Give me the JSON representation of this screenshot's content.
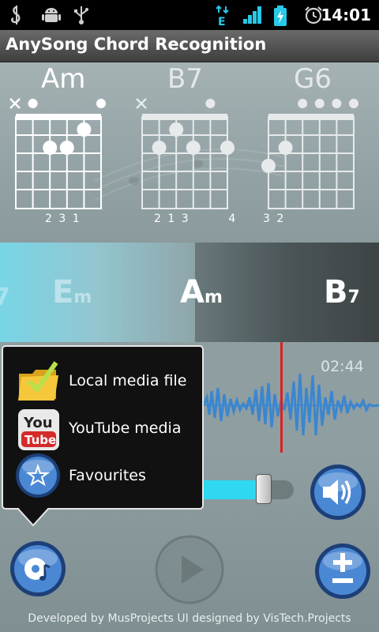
{
  "status_bar": {
    "time": "14:01",
    "icons": [
      "music-note-icon",
      "android-icon",
      "usb-icon",
      "data-transfer-icon",
      "signal-icon",
      "battery-charging-icon",
      "alarm-icon"
    ]
  },
  "title_bar": {
    "title": "AnySong Chord Recognition"
  },
  "chord_diagrams": [
    {
      "name": "Am",
      "fingering": "2 3 1",
      "active": true
    },
    {
      "name": "B7",
      "fingering": "2 1 3      4",
      "active": false
    },
    {
      "name": "G6",
      "fingering": "3 2",
      "active": false
    }
  ],
  "chord_strip": {
    "prev": "Em",
    "current": "Am",
    "next": "B7"
  },
  "waveform": {
    "time": "02:44"
  },
  "source_menu": {
    "items": [
      {
        "label": "Local media file",
        "icon": "folder-icon"
      },
      {
        "label": "YouTube media",
        "icon": "youtube-icon"
      },
      {
        "label": "Favourites",
        "icon": "star-icon"
      }
    ]
  },
  "controls": {
    "volume_level": 0.75,
    "icons": [
      "media-source-icon",
      "play-icon",
      "volume-icon",
      "plus-minus-icon"
    ]
  },
  "footer": {
    "text": "Developed by MusProjects   UI designed by VisTech.Projects"
  },
  "colors": {
    "accent_cyan": "#2fd8f0",
    "playhead": "#e02020",
    "wave": "#3a86d0"
  }
}
